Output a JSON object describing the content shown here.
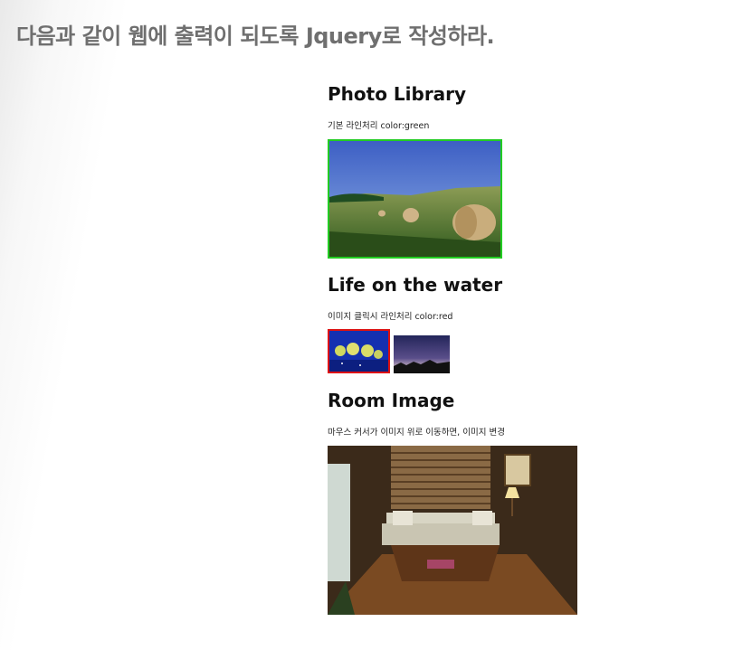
{
  "slide": {
    "title": "다음과 같이 웹에 출력이 되도록 Jquery로 작성하라."
  },
  "sections": [
    {
      "heading": "Photo Library",
      "description": "기본 라인처리 color:green",
      "border_color": "#22cc22"
    },
    {
      "heading": "Life on the water",
      "description": "이미지 클릭시 라인처리 color:red",
      "border_color": "#dd1111"
    },
    {
      "heading": "Room Image",
      "description": "마우스 커서가 이미지 위로 이동하면, 이미지 변경"
    }
  ]
}
